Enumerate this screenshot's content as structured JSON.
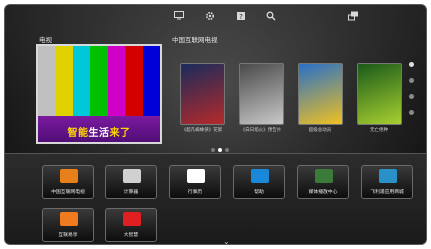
{
  "topbar": {
    "icons": [
      "tv-icon",
      "gear-icon",
      "help-icon",
      "search-icon",
      "screen-share-icon"
    ]
  },
  "tv": {
    "label": "电视",
    "banner_a": "智能",
    "banner_b": "生活",
    "banner_c": "来了",
    "bar_colors": [
      "#c0c0c0",
      "#e0d100",
      "#00c8d8",
      "#00c000",
      "#d000c8",
      "#d40000",
      "#0000d8"
    ]
  },
  "internet_tv": {
    "label": "中国互联网电视",
    "movies": [
      {
        "caption": "《超凡蜘蛛侠》花絮",
        "color1": "#1a2b5c",
        "color2": "#b52a2a"
      },
      {
        "caption": "《白日焰火》预告片",
        "color1": "#4a4a4a",
        "color2": "#c9c9c9"
      },
      {
        "caption": "超级总动员",
        "color1": "#2870c8",
        "color2": "#f0c020"
      },
      {
        "caption": "无亡绝种",
        "color1": "#1a5a1a",
        "color2": "#a8d030"
      }
    ]
  },
  "apps": [
    {
      "name": "中国互联网电视",
      "color": "#e8801a"
    },
    {
      "name": "计算器",
      "color": "#d0d0d0"
    },
    {
      "name": "行事历",
      "color": "#ffffff"
    },
    {
      "name": "帮助",
      "color": "#1a88d8"
    },
    {
      "name": "媒体播放中心",
      "color": "#3a7a3a"
    },
    {
      "name": "飞利浦应用商城",
      "color": "#2a90c8"
    },
    {
      "name": "互联易享",
      "color": "#f07a20"
    },
    {
      "name": "大智慧",
      "color": "#e02020"
    }
  ]
}
